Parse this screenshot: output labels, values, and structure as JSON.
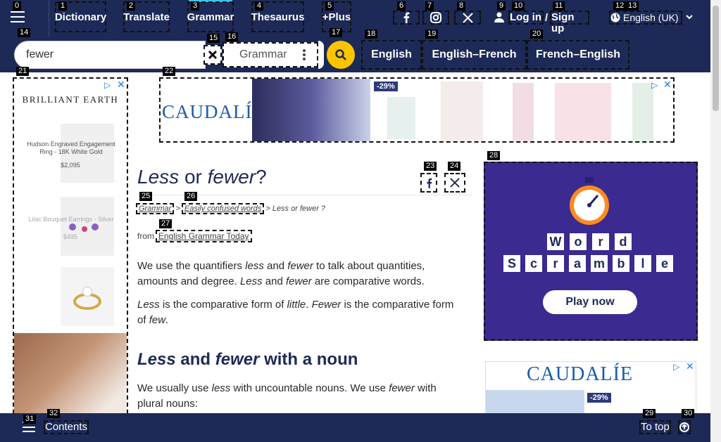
{
  "nav": {
    "items": [
      "Dictionary",
      "Translate",
      "Grammar",
      "Thesaurus",
      "+Plus"
    ],
    "login": "Log in",
    "slash": "/",
    "signup": "Sign up",
    "language": "English (UK)"
  },
  "badges": [
    "0",
    "1",
    "2",
    "3",
    "4",
    "5",
    "6",
    "7",
    "8",
    "9",
    "10",
    "11",
    "12",
    "13",
    "14",
    "15",
    "16",
    "17",
    "18",
    "19",
    "20",
    "21",
    "22",
    "23",
    "24",
    "25",
    "26",
    "27",
    "28",
    "29",
    "30",
    "31",
    "32"
  ],
  "search": {
    "value": "fewer",
    "dataset": "Grammar",
    "tabs": [
      "English",
      "English–French",
      "French–English"
    ]
  },
  "left_ad": {
    "brand": "BRILLIANT EARTH",
    "product1_name": "Hudson Engraved Engagement Ring - 18K White Gold",
    "product1_price": "$2,095",
    "product2_name": "Lilac Bouquet Earrings - Silver",
    "product2_price": "$495"
  },
  "top_ad": {
    "brand": "CAUDALÍE",
    "discount": "-29%"
  },
  "article": {
    "title_a": "Less",
    "title_or": "or",
    "title_b": "fewer",
    "title_q": "?",
    "crumb1": "Grammar",
    "crumb_sep1": ">",
    "crumb2": "Easily confused words",
    "crumb3": "> Less or fewer ?",
    "from": "from",
    "source": "English Grammar Today",
    "p1": {
      "a": "We use the quantifiers ",
      "b": "less",
      "c": " and ",
      "d": "fewer",
      "e": " to talk about quantities, amounts and degree. ",
      "f": "Less",
      "g": " and ",
      "h": "fewer",
      "i": " are comparative words."
    },
    "p2": {
      "a": "Less",
      "b": " is the comparative form of ",
      "c": "little",
      "d": ". ",
      "e": "Fewer",
      "f": " is the comparative form of ",
      "g": "few",
      "h": "."
    },
    "h2": {
      "a": "Less",
      "b": " and ",
      "c": "fewer",
      "d": " with a noun"
    },
    "p3": {
      "a": "We usually use ",
      "b": "less",
      "c": " with uncountable nouns. We use ",
      "d": "fewer",
      "e": " with plural nouns:"
    }
  },
  "right_ad": {
    "letters_row1": [
      "W",
      "o",
      "r",
      "d"
    ],
    "letters_row2": [
      "S",
      "c",
      "r",
      "a",
      "m",
      "b",
      "l",
      "e"
    ],
    "play": "Play now"
  },
  "right_ad2": {
    "brand": "CAUDALÍE",
    "discount": "-29%"
  },
  "bottom": {
    "contents": "Contents",
    "to_top": "To top"
  },
  "colors": {
    "navy": "#1d2a57",
    "accent_yellow": "#fec400",
    "cyan": "#34c6f2",
    "ad_purple": "#3b2a8f",
    "caudalie_blue": "#1b5ea8"
  }
}
